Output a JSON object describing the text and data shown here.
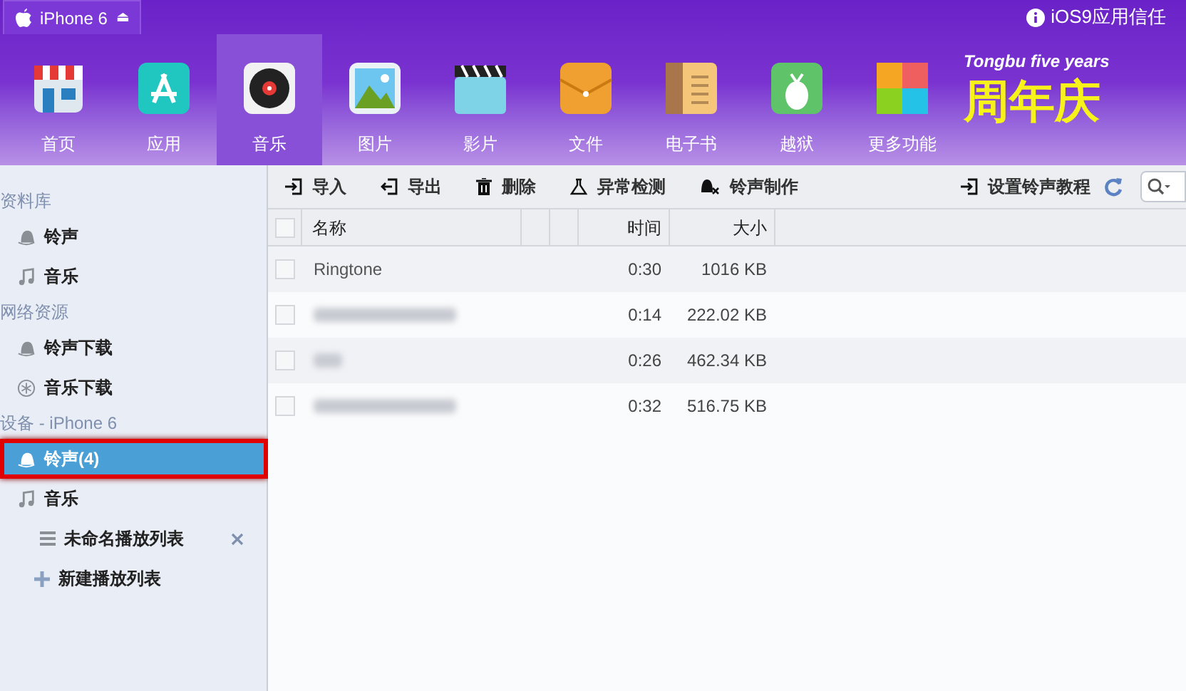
{
  "device_tab": {
    "label": "iPhone 6",
    "eject": "⏏"
  },
  "trust_link": "iOS9应用信任",
  "nav": [
    {
      "label": "首页",
      "kind": "home",
      "selected": false
    },
    {
      "label": "应用",
      "kind": "apps",
      "selected": false
    },
    {
      "label": "音乐",
      "kind": "music",
      "selected": true
    },
    {
      "label": "图片",
      "kind": "photos",
      "selected": false
    },
    {
      "label": "影片",
      "kind": "video",
      "selected": false
    },
    {
      "label": "文件",
      "kind": "files",
      "selected": false
    },
    {
      "label": "电子书",
      "kind": "books",
      "selected": false
    },
    {
      "label": "越狱",
      "kind": "jailbreak",
      "selected": false
    },
    {
      "label": "更多功能",
      "kind": "more",
      "selected": false
    }
  ],
  "banner": {
    "subtitle": "Tongbu five years",
    "title": "周年庆"
  },
  "sidebar": [
    {
      "heading": "资料库",
      "items": [
        {
          "label": "铃声",
          "kind": "ringtones",
          "selected": false
        },
        {
          "label": "音乐",
          "kind": "music",
          "selected": false
        }
      ]
    },
    {
      "heading": "网络资源",
      "items": [
        {
          "label": "铃声下载",
          "kind": "ringtones",
          "selected": false
        },
        {
          "label": "音乐下载",
          "kind": "download",
          "selected": false
        }
      ]
    },
    {
      "heading": "设备 - iPhone 6",
      "items": [
        {
          "label": "铃声(4)",
          "kind": "ringtones",
          "selected": true
        },
        {
          "label": "音乐",
          "kind": "music",
          "selected": false,
          "children": [
            {
              "label": "未命名播放列表",
              "kind": "playlist"
            },
            {
              "label": "新建播放列表",
              "kind": "new"
            }
          ]
        }
      ]
    }
  ],
  "toolbar": [
    {
      "label": "导入",
      "kind": "import"
    },
    {
      "label": "导出",
      "kind": "export"
    },
    {
      "label": "删除",
      "kind": "delete"
    },
    {
      "label": "异常检测",
      "kind": "check"
    },
    {
      "label": "铃声制作",
      "kind": "make"
    }
  ],
  "tutorial": "设置铃声教程",
  "table": {
    "select_all_checked": false,
    "columns": [
      "名称",
      "时间",
      "大小"
    ],
    "rows": [
      {
        "name": "Ringtone",
        "blurred": false,
        "checked": false,
        "time": "0:30",
        "size": "1016 KB"
      },
      {
        "blurred": true,
        "checked": false,
        "time": "0:14",
        "size": "222.02 KB"
      },
      {
        "blurred": true,
        "checked": false,
        "time": "0:26",
        "size": "462.34 KB"
      },
      {
        "blurred": true,
        "checked": false,
        "time": "0:32",
        "size": "516.75 KB"
      }
    ]
  }
}
